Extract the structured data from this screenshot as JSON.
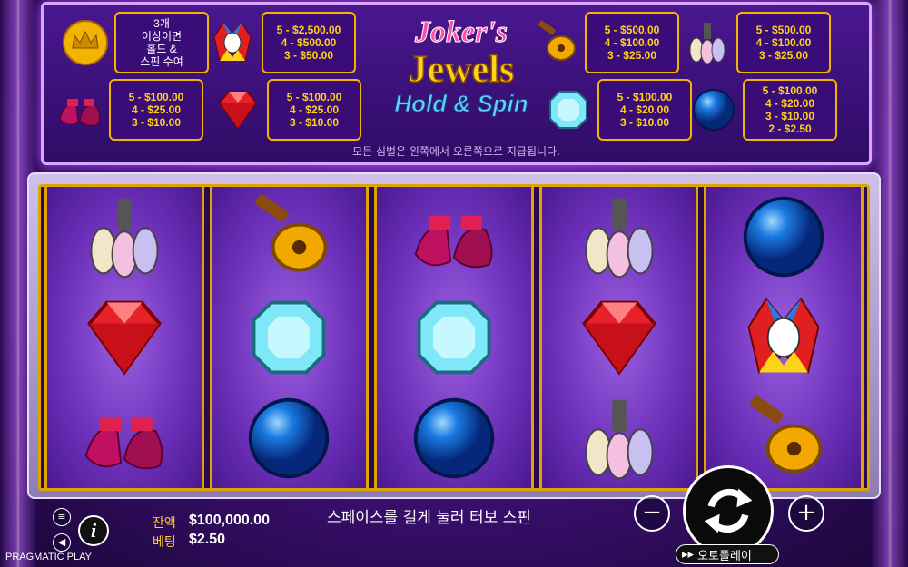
{
  "paytable": {
    "bonus_text": [
      "3개",
      "이상이면",
      "홀드 &",
      "스핀 수여"
    ],
    "items": [
      {
        "symbol": "crown-coin",
        "lines": [
          "3개",
          "이상이면",
          "홀드 &",
          "스핀 수여"
        ]
      },
      {
        "symbol": "joker",
        "lines": [
          "5 - $2,500.00",
          "4 - $500.00",
          "3 - $50.00"
        ]
      },
      {
        "symbol": "lute",
        "lines": [
          "5 - $500.00",
          "4 - $100.00",
          "3 - $25.00"
        ]
      },
      {
        "symbol": "bowling-pins",
        "lines": [
          "5 - $500.00",
          "4 - $100.00",
          "3 - $25.00"
        ]
      },
      {
        "symbol": "jester-shoes",
        "lines": [
          "5 - $100.00",
          "4 - $25.00",
          "3 - $10.00"
        ]
      },
      {
        "symbol": "red-gem",
        "lines": [
          "5 - $100.00",
          "4 - $25.00",
          "3 - $10.00"
        ]
      },
      {
        "symbol": "blue-diamond",
        "lines": [
          "5 - $100.00",
          "4 - $20.00",
          "3 - $10.00"
        ]
      },
      {
        "symbol": "blue-orb",
        "lines": [
          "5 - $100.00",
          "4 - $20.00",
          "3 - $10.00",
          "2 - $2.50"
        ]
      }
    ],
    "note": "모든 심벌은 왼쪽에서 오른쪽으로 지급됩니다."
  },
  "logo": {
    "line1": "Joker's",
    "line2": "Jewels",
    "line3": "Hold & Spin"
  },
  "reels": [
    [
      "bowling-pins",
      "red-gem",
      "jester-shoes"
    ],
    [
      "lute",
      "blue-diamond",
      "blue-orb"
    ],
    [
      "jester-shoes",
      "blue-diamond",
      "blue-orb"
    ],
    [
      "bowling-pins",
      "red-gem",
      "bowling-pins"
    ],
    [
      "blue-orb",
      "joker",
      "lute"
    ]
  ],
  "footer": {
    "balance_label": "잔액",
    "balance_value": "$100,000.00",
    "bet_label": "베팅",
    "bet_value": "$2.50",
    "hint": "스페이스를 길게 눌러 터보 스핀",
    "autoplay_label": "오토플레이",
    "brand": "PRAGMATIC PLAY",
    "minus": "−",
    "plus": "+",
    "info": "i"
  },
  "colors": {
    "gold": "#ffd21a",
    "frame": "#e0a400",
    "reel_bg": "#6b2fb8"
  }
}
